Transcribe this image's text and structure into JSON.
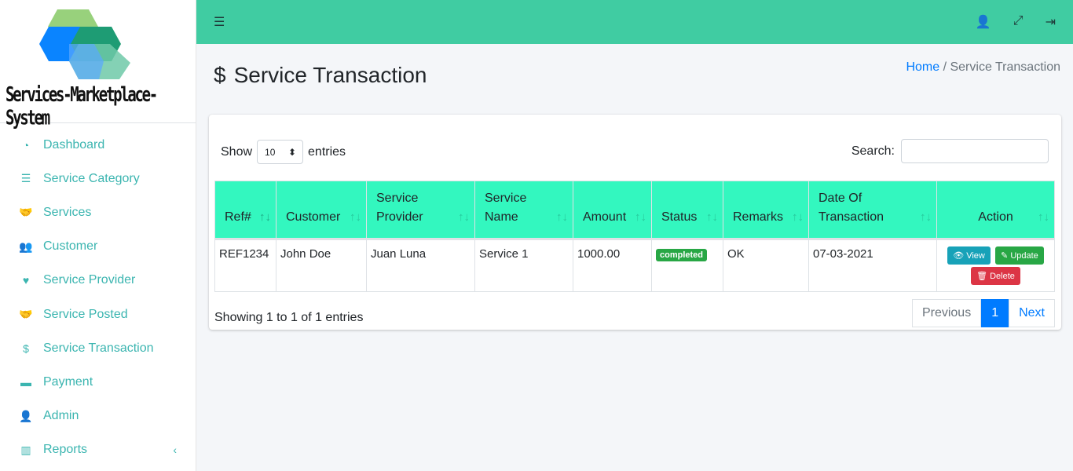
{
  "brand": {
    "name": "Services-Marketplace-System"
  },
  "sidebar": {
    "items": [
      {
        "label": "Dashboard",
        "icon": "◔"
      },
      {
        "label": "Service Category",
        "icon": "☰"
      },
      {
        "label": "Services",
        "icon": "🤝"
      },
      {
        "label": "Customer",
        "icon": "👥"
      },
      {
        "label": "Service Provider",
        "icon": "♥"
      },
      {
        "label": "Service Posted",
        "icon": "🤝"
      },
      {
        "label": "Service Transaction",
        "icon": "$"
      },
      {
        "label": "Payment",
        "icon": "▬"
      },
      {
        "label": "Admin",
        "icon": "👤"
      },
      {
        "label": "Reports",
        "icon": "▥",
        "chevron": "‹"
      }
    ]
  },
  "topbar": {
    "menu_icon": "☰",
    "icons": [
      "👤",
      "⤢",
      "⇥"
    ]
  },
  "page": {
    "title": "Service Transaction",
    "icon": "$"
  },
  "breadcrumb": {
    "home": "Home",
    "sep": "/",
    "current": "Service Transaction"
  },
  "table_controls": {
    "show": "Show",
    "entries_value": "10",
    "entries": "entries",
    "search_label": "Search:",
    "search_value": ""
  },
  "table": {
    "columns": [
      "Ref#",
      "Customer",
      "Service Provider",
      "Service Name",
      "Amount",
      "Status",
      "Remarks",
      "Date Of Transaction",
      "Action"
    ],
    "rows": [
      {
        "ref": "REF1234",
        "customer": "John Doe",
        "provider": "Juan Luna",
        "service": "Service 1",
        "amount": "1000.00",
        "status": "completed",
        "remarks": "OK",
        "date": "07-03-2021"
      }
    ],
    "actions": {
      "view": "View",
      "update": "Update",
      "delete": "Delete"
    }
  },
  "footer": {
    "info": "Showing 1 to 1 of 1 entries",
    "previous": "Previous",
    "page": "1",
    "next": "Next"
  },
  "colors": {
    "topbar": "#40cca2",
    "header": "#33f7bf",
    "sidebar_text": "#3bb5b0",
    "view": "#17a2b8",
    "update": "#28a745",
    "delete": "#dc3545"
  }
}
